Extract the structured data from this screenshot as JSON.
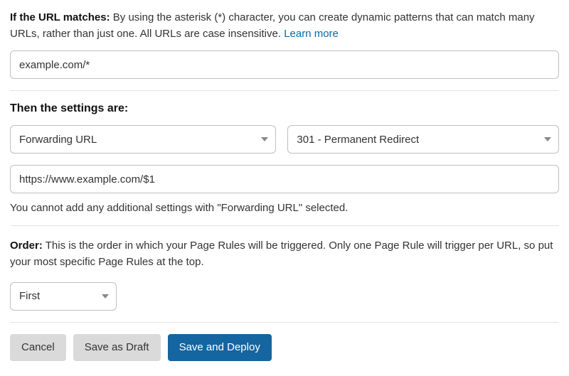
{
  "match": {
    "label": "If the URL matches:",
    "description": "By using the asterisk (*) character, you can create dynamic patterns that can match many URLs, rather than just one. All URLs are case insensitive.",
    "learn_more": "Learn more",
    "url_pattern": "example.com/*"
  },
  "settings": {
    "heading": "Then the settings are:",
    "setting_type": "Forwarding URL",
    "redirect_type": "301 - Permanent Redirect",
    "destination_url": "https://www.example.com/$1",
    "note": "You cannot add any additional settings with \"Forwarding URL\" selected."
  },
  "order": {
    "label": "Order:",
    "description": "This is the order in which your Page Rules will be triggered. Only one Page Rule will trigger per URL, so put your most specific Page Rules at the top.",
    "value": "First"
  },
  "actions": {
    "cancel": "Cancel",
    "save_draft": "Save as Draft",
    "save_deploy": "Save and Deploy"
  }
}
